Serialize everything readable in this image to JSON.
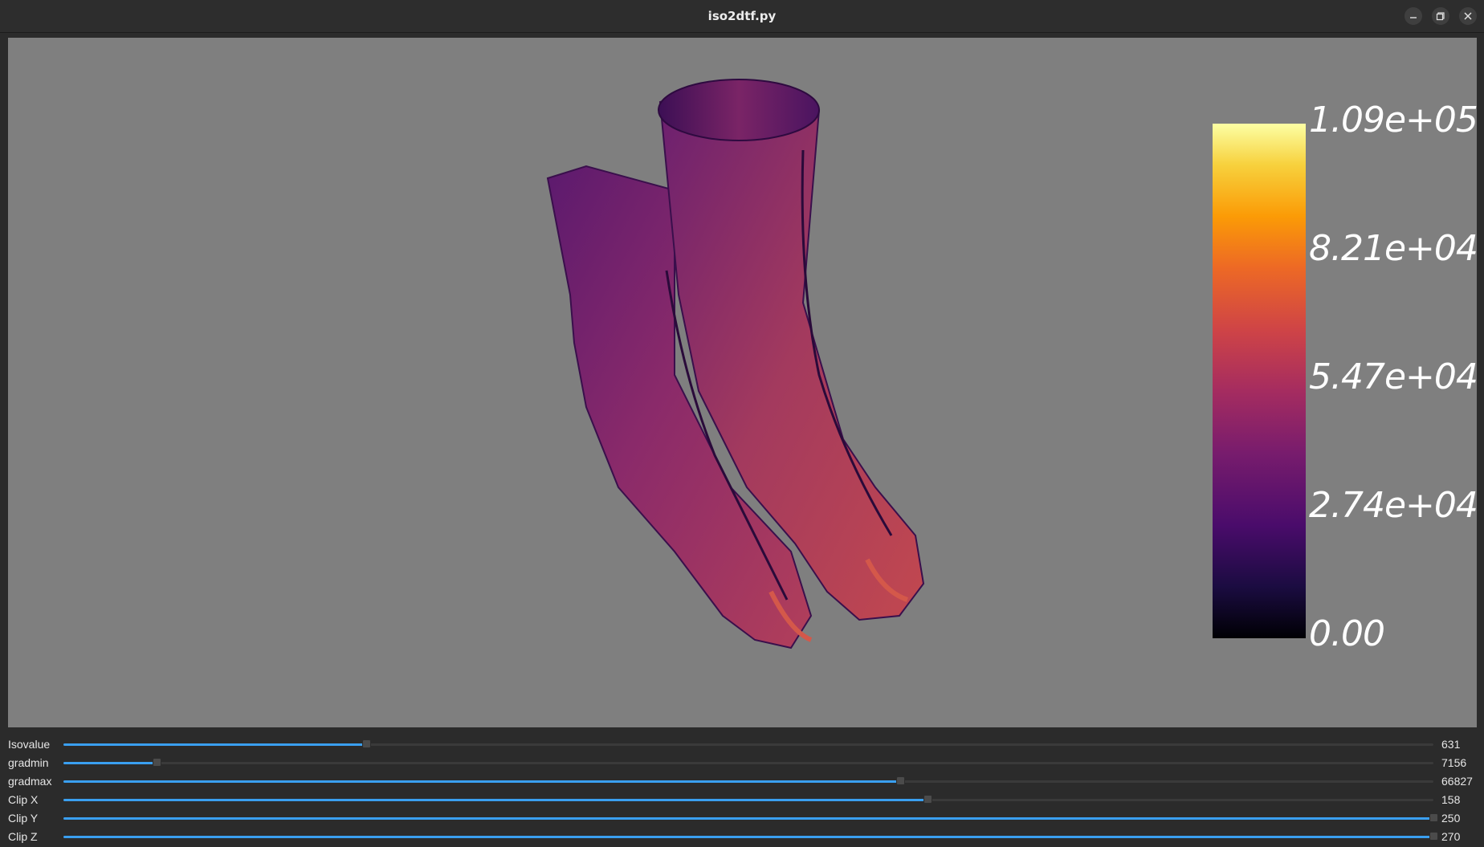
{
  "window": {
    "title": "iso2dtf.py",
    "controls": [
      "minimize-icon",
      "maximize-icon",
      "close-icon"
    ]
  },
  "viewport": {
    "background": "#7f7f7f",
    "colorbar": {
      "colormap": "inferno",
      "labels": [
        "1.09e+05",
        "8.21e+04",
        "5.47e+04",
        "2.74e+04",
        "0.00"
      ]
    }
  },
  "sliders": [
    {
      "label": "Isovalue",
      "value": "631",
      "fraction": 0.221
    },
    {
      "label": "gradmin",
      "value": "7156",
      "fraction": 0.068
    },
    {
      "label": "gradmax",
      "value": "66827",
      "fraction": 0.611
    },
    {
      "label": "Clip X",
      "value": "158",
      "fraction": 0.631
    },
    {
      "label": "Clip Y",
      "value": "250",
      "fraction": 1.0
    },
    {
      "label": "Clip Z",
      "value": "270",
      "fraction": 1.0
    }
  ],
  "colors": {
    "accent": "#3a9ff0",
    "titlebar": "#2d2d2d",
    "panel": "#2b2b2b"
  }
}
